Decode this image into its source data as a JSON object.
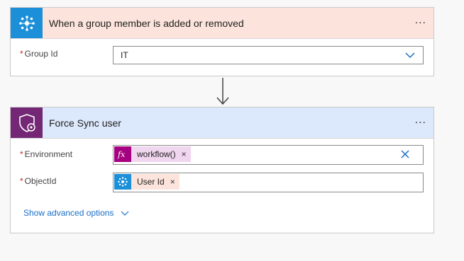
{
  "trigger": {
    "title": "When a group member is added or removed",
    "more_label": "...",
    "fields": [
      {
        "required": "*",
        "label": "Group Id",
        "value": "IT"
      }
    ]
  },
  "action": {
    "title": "Force Sync user",
    "more_label": "...",
    "fields": [
      {
        "required": "*",
        "label": "Environment",
        "token_icon": "fx-icon",
        "token_text": "workflow()",
        "token_remove": "×"
      },
      {
        "required": "*",
        "label": "ObjectId",
        "token_icon": "group-connector-icon",
        "token_text": "User Id",
        "token_remove": "×"
      }
    ],
    "advanced_label": "Show advanced options"
  },
  "colors": {
    "trigger_header_bg": "#fce4dc",
    "trigger_icon_bg": "#1b8fd8",
    "action_header_bg": "#dce8fb",
    "action_icon_bg": "#742774",
    "fx_token_icon_bg": "#a4007f",
    "link": "#1a6fc6",
    "required": "#c42b1c"
  }
}
